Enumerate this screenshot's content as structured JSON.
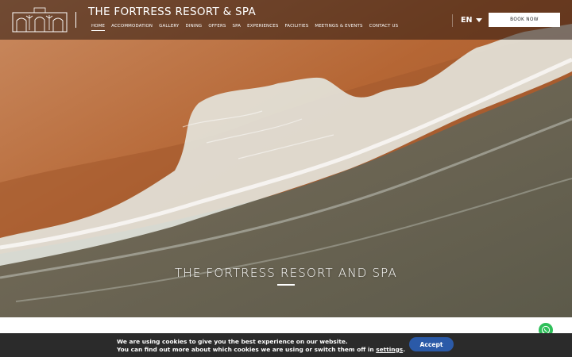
{
  "header": {
    "site_title": "THE FORTRESS RESORT & SPA",
    "nav": [
      {
        "label": "HOME",
        "active": true
      },
      {
        "label": "ACCOMMODATION"
      },
      {
        "label": "GALLERY"
      },
      {
        "label": "DINING"
      },
      {
        "label": "OFFERS"
      },
      {
        "label": "SPA"
      },
      {
        "label": "EXPERIENCES"
      },
      {
        "label": "FACILITIES"
      },
      {
        "label": "MEETINGS & EVENTS"
      },
      {
        "label": "CONTACT US"
      }
    ],
    "language": "EN",
    "book_label": "BOOK NOW"
  },
  "hero": {
    "title": "THE FORTRESS RESORT AND SPA"
  },
  "cookie": {
    "line1": "We are using cookies to give you the best experience on our website.",
    "line2": "You can find out more about which cookies we are using or switch them off in",
    "link": "settings",
    "after": ".",
    "accept_label": "Accept"
  },
  "icons": {
    "whatsapp": "whatsapp-icon",
    "caret": "caret-down-icon"
  },
  "colors": {
    "sand": "#b86a3a",
    "sea": "#6b6a58",
    "foam": "#e9ece6",
    "accept": "#2b5aa8",
    "cookie_bg": "#2b2b2b",
    "whatsapp": "#2fbf5a"
  }
}
